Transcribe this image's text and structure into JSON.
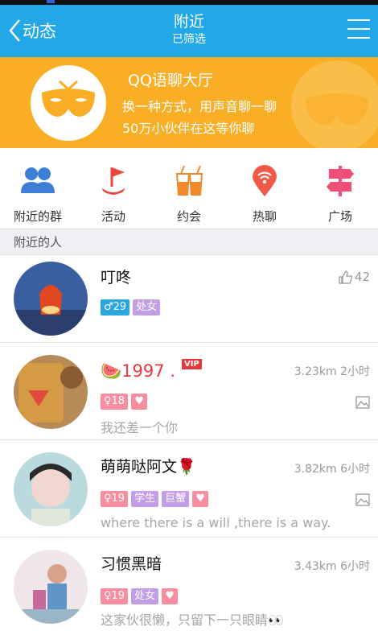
{
  "titlebar": {
    "back_label": "动态",
    "title": "附近",
    "subtitle": "已筛选"
  },
  "banner": {
    "title": "QQ语聊大厅",
    "line1": "换一种方式，用声音聊一聊",
    "line2": "50万小伙伴在这等你聊"
  },
  "icons": [
    {
      "label": "附近的群",
      "icon": "group-icon"
    },
    {
      "label": "活动",
      "icon": "flag-icon"
    },
    {
      "label": "约会",
      "icon": "drinks-icon"
    },
    {
      "label": "热聊",
      "icon": "signal-pin-icon"
    },
    {
      "label": "广场",
      "icon": "signpost-icon"
    }
  ],
  "section_title": "附近的人",
  "people": [
    {
      "name": "叮咚",
      "likes": "42",
      "tags": [
        "♂29",
        "处女"
      ],
      "meta": "",
      "signature": ""
    },
    {
      "name": "🍉1997 .",
      "vip": "VIP",
      "tags": [
        "♀18",
        "♥"
      ],
      "meta": "3.23km 2小时",
      "signature": "我还差一个你"
    },
    {
      "name": "萌萌哒阿文🌹",
      "tags": [
        "♀19",
        "学生",
        "巨蟹",
        "♥"
      ],
      "meta": "3.82km 6小时",
      "signature": "where there is a will ,there is a way."
    },
    {
      "name": "习惯黑暗",
      "tags": [
        "♀19",
        "处女",
        "♥"
      ],
      "meta": "3.43km 6小时",
      "signature": "这家伙很懒，只留下一只眼睛👀"
    }
  ],
  "colors": {
    "header": "#22a8e6",
    "banner": "#f9ae25",
    "male": "#2ba6e1",
    "female": "#f78d9f",
    "zodiac": "#c39ee6",
    "vip": "#e8383d"
  }
}
